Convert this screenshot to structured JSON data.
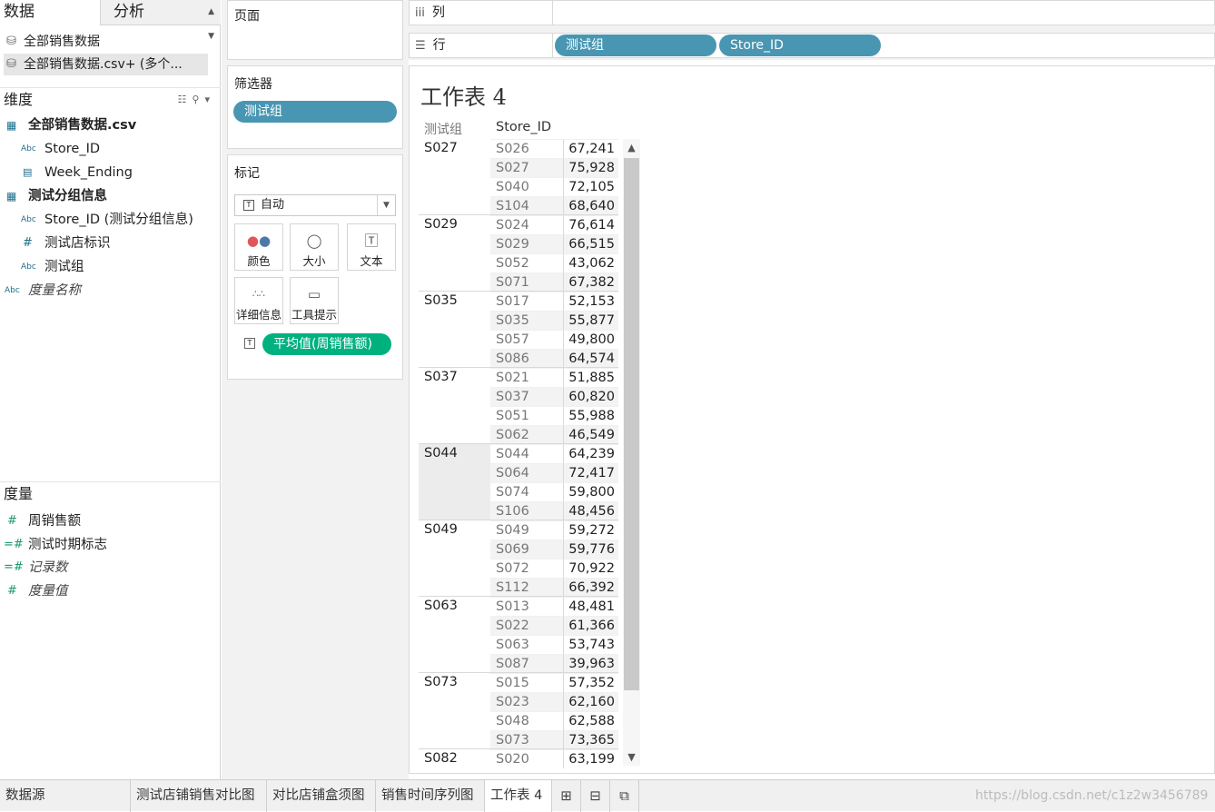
{
  "data_pane": {
    "tab_data": "数据",
    "tab_analysis": "分析",
    "sources": [
      "全部销售数据",
      "全部销售数据.csv+ (多个..."
    ],
    "dimensions_label": "维度",
    "dimensions": [
      {
        "label": "全部销售数据.csv",
        "icon": "table-icon",
        "bold": true
      },
      {
        "label": "Store_ID",
        "icon": "Abc"
      },
      {
        "label": "Week_Ending",
        "icon": "date-icon"
      },
      {
        "label": "测试分组信息",
        "icon": "table-icon",
        "bold": true
      },
      {
        "label": "Store_ID (测试分组信息)",
        "icon": "Abc"
      },
      {
        "label": "测试店标识",
        "icon": "#"
      },
      {
        "label": "测试组",
        "icon": "Abc"
      },
      {
        "label": "度量名称",
        "icon": "Abc",
        "italic": true
      }
    ],
    "measures_label": "度量",
    "measures": [
      {
        "label": "周销售额",
        "icon": "#"
      },
      {
        "label": "测试时期标志",
        "icon": "=#"
      },
      {
        "label": "记录数",
        "icon": "=#",
        "italic": true
      },
      {
        "label": "度量值",
        "icon": "#",
        "italic": true
      }
    ]
  },
  "cards": {
    "pages_title": "页面",
    "filters_title": "筛选器",
    "filter_pill": "测试组",
    "marks_title": "标记",
    "mark_type": "自动",
    "mark_buttons": [
      "颜色",
      "大小",
      "文本",
      "详细信息",
      "工具提示"
    ],
    "text_pill": "平均值(周销售额)"
  },
  "shelves": {
    "columns_label": "列",
    "rows_label": "行",
    "row_pills": [
      "测试组",
      "Store_ID"
    ]
  },
  "view": {
    "title": "工作表 4",
    "header_group": "测试组",
    "header_store": "Store_ID",
    "groups": [
      {
        "name": "S027",
        "rows": [
          [
            "S026",
            "67,241"
          ],
          [
            "S027",
            "75,928"
          ],
          [
            "S040",
            "72,105"
          ],
          [
            "S104",
            "68,640"
          ]
        ]
      },
      {
        "name": "S029",
        "rows": [
          [
            "S024",
            "76,614"
          ],
          [
            "S029",
            "66,515"
          ],
          [
            "S052",
            "43,062"
          ],
          [
            "S071",
            "67,382"
          ]
        ]
      },
      {
        "name": "S035",
        "rows": [
          [
            "S017",
            "52,153"
          ],
          [
            "S035",
            "55,877"
          ],
          [
            "S057",
            "49,800"
          ],
          [
            "S086",
            "64,574"
          ]
        ]
      },
      {
        "name": "S037",
        "rows": [
          [
            "S021",
            "51,885"
          ],
          [
            "S037",
            "60,820"
          ],
          [
            "S051",
            "55,988"
          ],
          [
            "S062",
            "46,549"
          ]
        ]
      },
      {
        "name": "S044",
        "rows": [
          [
            "S044",
            "64,239"
          ],
          [
            "S064",
            "72,417"
          ],
          [
            "S074",
            "59,800"
          ],
          [
            "S106",
            "48,456"
          ]
        ]
      },
      {
        "name": "S049",
        "rows": [
          [
            "S049",
            "59,272"
          ],
          [
            "S069",
            "59,776"
          ],
          [
            "S072",
            "70,922"
          ],
          [
            "S112",
            "66,392"
          ]
        ]
      },
      {
        "name": "S063",
        "rows": [
          [
            "S013",
            "48,481"
          ],
          [
            "S022",
            "61,366"
          ],
          [
            "S063",
            "53,743"
          ],
          [
            "S087",
            "39,963"
          ]
        ]
      },
      {
        "name": "S073",
        "rows": [
          [
            "S015",
            "57,352"
          ],
          [
            "S023",
            "62,160"
          ],
          [
            "S048",
            "62,588"
          ],
          [
            "S073",
            "73,365"
          ]
        ]
      },
      {
        "name": "S082",
        "rows": [
          [
            "S020",
            "63,199"
          ]
        ]
      }
    ]
  },
  "bottom_tabs": {
    "datasource": "数据源",
    "sheets": [
      "测试店铺销售对比图",
      "对比店铺盒须图",
      "销售时间序列图",
      "工作表 4"
    ],
    "active": "工作表 4",
    "watermark": "https://blog.csdn.net/c1z2w3456789"
  }
}
